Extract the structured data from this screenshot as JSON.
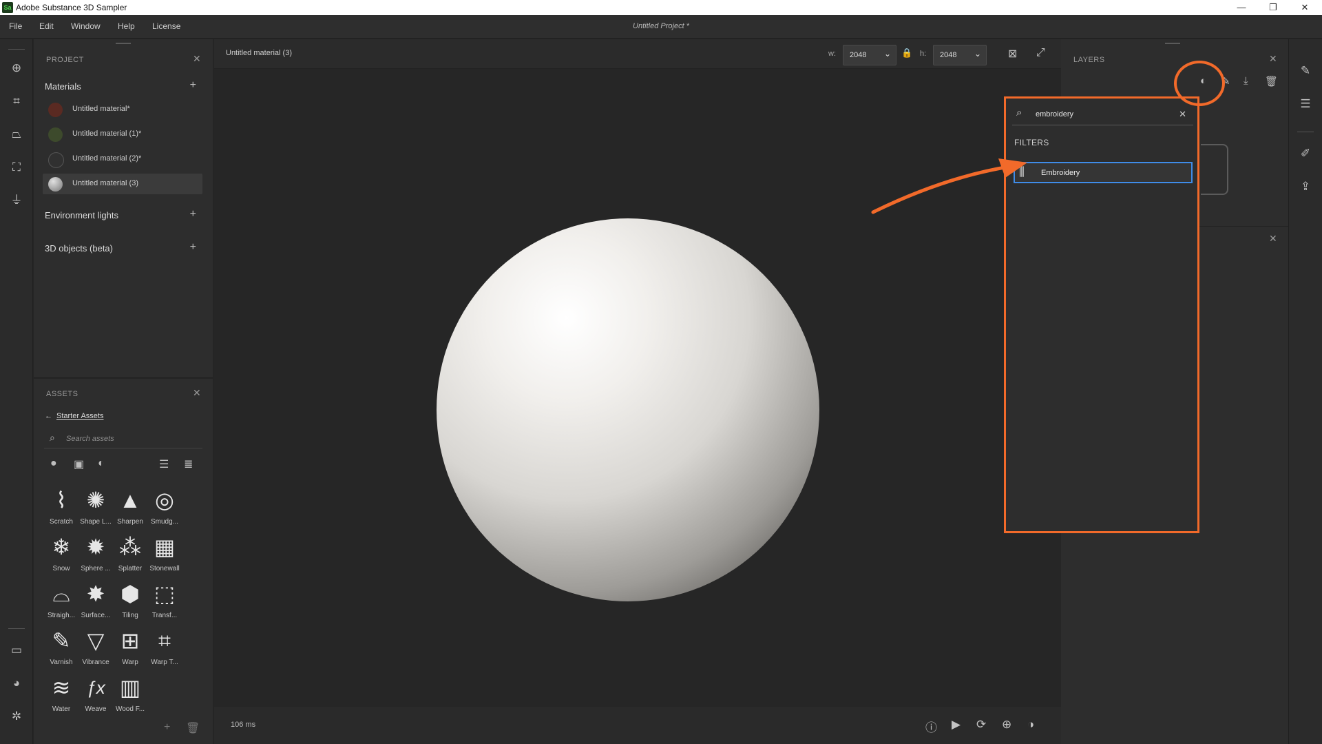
{
  "window": {
    "title": "Adobe Substance 3D Sampler",
    "logo": "Sa",
    "controls": {
      "minimize": "—",
      "restore": "❐",
      "close": "✕"
    }
  },
  "menubar": {
    "items": [
      "File",
      "Edit",
      "Window",
      "Help",
      "License"
    ],
    "project_title": "Untitled Project *"
  },
  "project_panel": {
    "title": "PROJECT",
    "materials_heading": "Materials",
    "materials": [
      {
        "name": "Untitled material*",
        "thumb_color": "#5a2a22"
      },
      {
        "name": "Untitled material (1)*",
        "thumb_color": "#3d4a2c"
      },
      {
        "name": "Untitled material (2)*",
        "thumb_color": "#303030"
      },
      {
        "name": "Untitled material (3)",
        "thumb_color": "#a8a8a8"
      }
    ],
    "active_material_index": 3,
    "environment_heading": "Environment lights",
    "objects_heading": "3D objects (beta)"
  },
  "assets_panel": {
    "title": "ASSETS",
    "breadcrumb": "Starter Assets",
    "search_placeholder": "Search assets",
    "assets": [
      {
        "name": "Scratch",
        "glyph": "⌇"
      },
      {
        "name": "Shape L...",
        "glyph": "✺"
      },
      {
        "name": "Sharpen",
        "glyph": "▲"
      },
      {
        "name": "Smudg...",
        "glyph": "◎"
      },
      {
        "name": "Snow",
        "glyph": "❄"
      },
      {
        "name": "Sphere ...",
        "glyph": "✹"
      },
      {
        "name": "Splatter",
        "glyph": "⁂"
      },
      {
        "name": "Stonewall",
        "glyph": "▦"
      },
      {
        "name": "Straigh...",
        "glyph": "⌓"
      },
      {
        "name": "Surface...",
        "glyph": "✸"
      },
      {
        "name": "Tiling",
        "glyph": "⬢"
      },
      {
        "name": "Transf...",
        "glyph": "⬚"
      },
      {
        "name": "Varnish",
        "glyph": "✎"
      },
      {
        "name": "Vibrance",
        "glyph": "▽"
      },
      {
        "name": "Warp",
        "glyph": "⊞"
      },
      {
        "name": "Warp T...",
        "glyph": "⌗"
      },
      {
        "name": "Water",
        "glyph": "≋"
      },
      {
        "name": "Weave",
        "glyph": "ƒx"
      },
      {
        "name": "Wood F...",
        "glyph": "▥"
      }
    ]
  },
  "viewport": {
    "material_name": "Untitled material (3)",
    "width_label": "w:",
    "width_value": "2048",
    "height_label": "h:",
    "height_value": "2048",
    "render_time": "106 ms"
  },
  "layers_panel": {
    "title": "LAYERS"
  },
  "search_popup": {
    "query": "embroidery",
    "section_label": "FILTERS",
    "results": [
      {
        "label": "Embroidery",
        "icon": "embroidery-filter-icon"
      }
    ]
  },
  "colors": {
    "annotation": "#f26a2a",
    "selection": "#3f8ce8"
  }
}
